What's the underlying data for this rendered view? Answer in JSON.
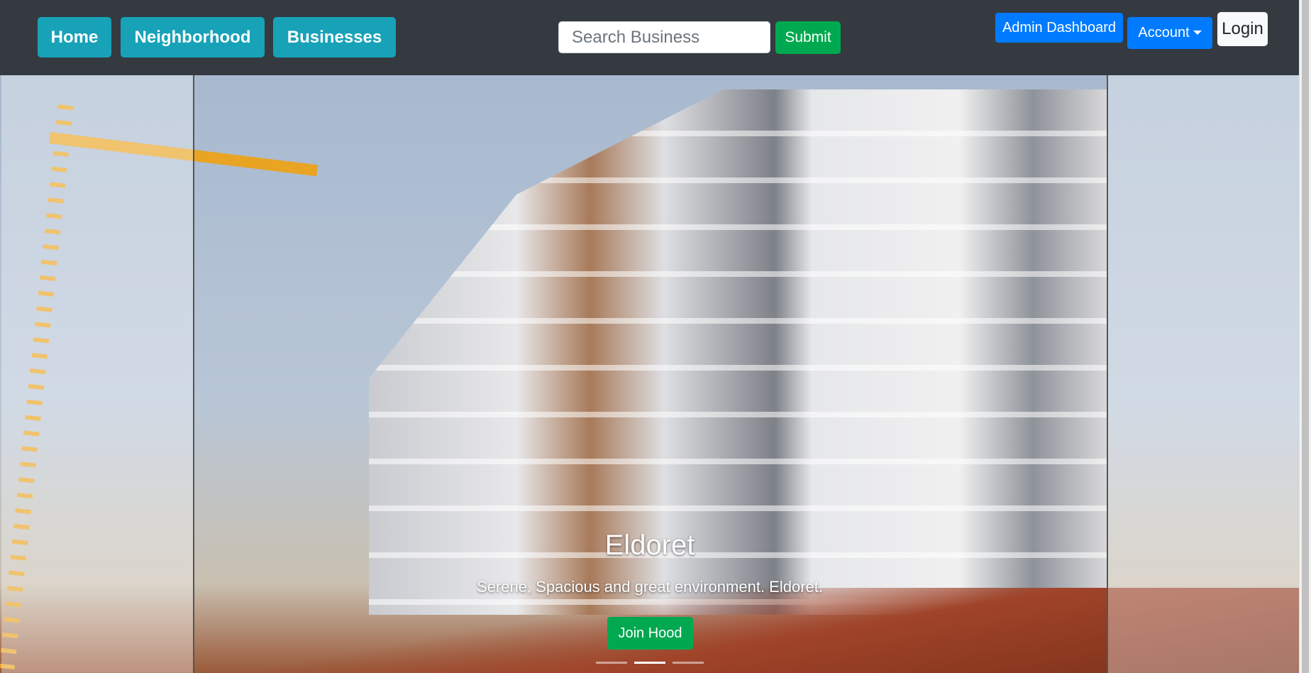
{
  "navbar": {
    "home_label": "Home",
    "neighborhood_label": "Neighborhood",
    "businesses_label": "Businesses",
    "search_placeholder": "Search Business",
    "submit_label": "Submit",
    "admin_label": "Admin Dashboard",
    "account_label": "Account",
    "login_label": "Login"
  },
  "carousel": {
    "active_index": 1,
    "indicator_count": 3,
    "caption_title": "Eldoret",
    "caption_text": "Serene, Spacious and great environment. Eldoret.",
    "join_label": "Join Hood"
  },
  "colors": {
    "navbar_bg": "#343a40",
    "nav_button": "#17a2b8",
    "primary": "#007bff",
    "success": "#00a94f",
    "light": "#f8f9fa"
  }
}
